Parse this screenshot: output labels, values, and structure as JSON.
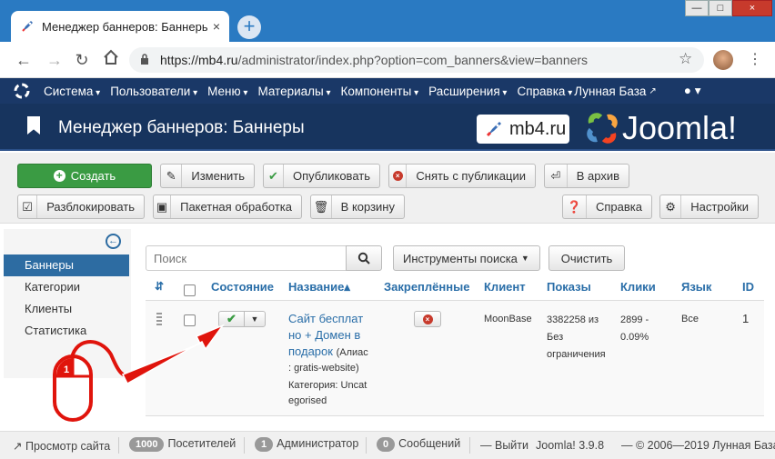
{
  "browser": {
    "tab_title": "Менеджер баннеров: Баннеры",
    "tab_close": "×",
    "new_tab": "+",
    "url_host": "https://mb4.ru",
    "url_path": "/administrator/index.php?option=com_banners&view=banners",
    "window_min": "—",
    "window_max": "□",
    "window_close": "×"
  },
  "topmenu": {
    "items": [
      "Система",
      "Пользователи",
      "Меню",
      "Материалы",
      "Компоненты",
      "Расширения",
      "Справка"
    ],
    "site_name": "Лунная База",
    "user_icon": "user-icon"
  },
  "header": {
    "title": "Менеджер баннеров: Баннеры",
    "site_logo_text": "mb4.ru",
    "brand": "Joomla!"
  },
  "toolbar": {
    "create": "Создать",
    "edit": "Изменить",
    "publish": "Опубликовать",
    "unpublish": "Снять с публикации",
    "archive": "В архив",
    "unlock": "Разблокировать",
    "batch": "Пакетная обработка",
    "trash": "В корзину",
    "help": "Справка",
    "options": "Настройки"
  },
  "sidebar": {
    "items": [
      "Баннеры",
      "Категории",
      "Клиенты",
      "Статистика"
    ],
    "active_index": 0
  },
  "filters": {
    "search_placeholder": "Поиск",
    "search_tools": "Инструменты поиска",
    "clear": "Очистить"
  },
  "table": {
    "columns": {
      "status": "Состояние",
      "name": "Название",
      "pinned": "Закреплённые",
      "client": "Клиент",
      "impressions": "Показы",
      "clicks": "Клики",
      "language": "Язык",
      "id": "ID"
    },
    "sort_arrow": "▴",
    "rows": [
      {
        "name_lines": [
          "Сайт бесплат",
          "но + Домен в",
          "подарок"
        ],
        "alias": "(Алиас",
        "alias_value": ": gratis-website)",
        "category": "Категория: Uncat",
        "category_rest": "egorised",
        "client": "MoonBase",
        "impressions_1": "3382258 из",
        "impressions_2": "Без",
        "impressions_3": "ограничения",
        "clicks_1": "2899 -",
        "clicks_2": "0.09%",
        "language": "Все",
        "id": "1",
        "published": true
      }
    ]
  },
  "footer": {
    "view_site": "Просмотр сайта",
    "visitors_count": "1000",
    "visitors_label": "Посетителей",
    "admins_count": "1",
    "admins_label": "Администратор",
    "messages_count": "0",
    "messages_label": "Сообщений",
    "logout": "Выйти",
    "version": "Joomla! 3.9.8",
    "copyright": "— © 2006—2019 Лунная База"
  },
  "annotation": {
    "mouse_button_number": "1",
    "color": "#e0140c"
  }
}
